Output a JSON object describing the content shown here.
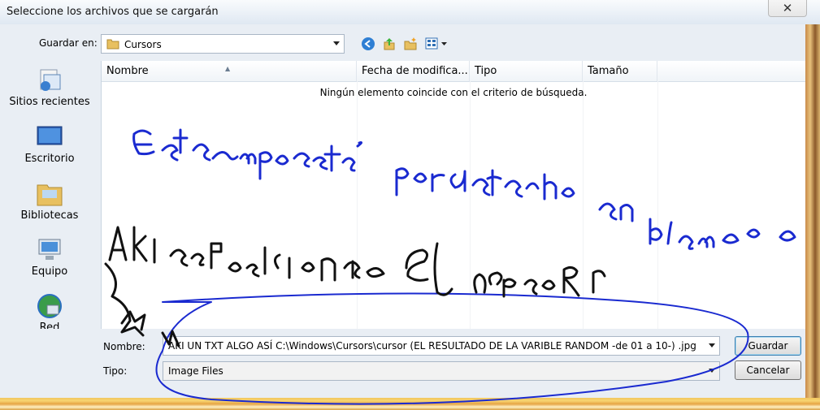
{
  "dialog": {
    "title": "Seleccione los archivos que se cargarán",
    "close_symbol": "✕"
  },
  "toolbar": {
    "save_in_label": "Guardar en:",
    "save_in_value": "Cursors",
    "icons": [
      "back-icon",
      "up-folder-icon",
      "new-folder-icon",
      "view-menu-icon"
    ]
  },
  "sidebar": {
    "items": [
      {
        "label": "Sitios recientes",
        "icon": "recent-places-icon"
      },
      {
        "label": "Escritorio",
        "icon": "desktop-icon"
      },
      {
        "label": "Bibliotecas",
        "icon": "libraries-icon"
      },
      {
        "label": "Equipo",
        "icon": "computer-icon"
      },
      {
        "label": "Red",
        "icon": "network-icon"
      }
    ]
  },
  "filelist": {
    "columns": [
      "Nombre",
      "Fecha de modifica...",
      "Tipo",
      "Tamaño"
    ],
    "empty_message": "Ningún elemento coincide con el criterio de búsqueda."
  },
  "bottom": {
    "name_label": "Nombre:",
    "name_value": "AKI UN TXT ALGO ASÍ   C:\\Windows\\Cursors\\cursor (EL RESULTADO DE LA VARIBLE RANDOM -de 01 a 10-) .jpg",
    "type_label": "Tipo:",
    "type_value": "Image Files",
    "save_button": "Guardar",
    "cancel_button": "Cancelar"
  },
  "colors": {
    "ink": "#1a2ad0",
    "black_ink": "#111111",
    "folder": "#e8c060"
  }
}
